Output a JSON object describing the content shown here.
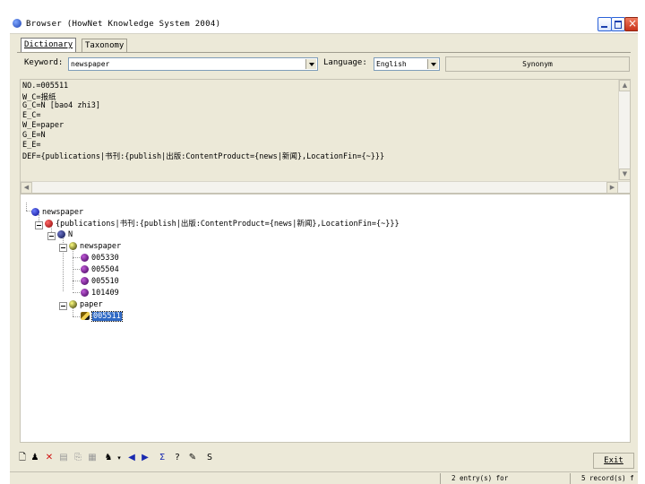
{
  "window": {
    "title": "Browser (HowNet Knowledge System 2004)",
    "icon": "app-globe-icon"
  },
  "tabs": [
    {
      "label": "Dictionary",
      "active": true
    },
    {
      "label": "Taxonomy",
      "active": false
    }
  ],
  "keyword": {
    "label": "Keyword:",
    "value": "newspaper"
  },
  "language": {
    "label": "Language:",
    "value": "English"
  },
  "synonym_button": "Synonym",
  "record_lines": [
    "NO.=005511",
    "W_C=报纸",
    "G_C=N [bao4 zhi3]",
    "E_C=",
    "W_E=paper",
    "G_E=N",
    "E_E=",
    "DEF={publications|书刊:{publish|出版:ContentProduct={news|新闻},LocationFin={~}}}"
  ],
  "tree": {
    "root": "newspaper",
    "def": "{publications|书刊:{publish|出版:ContentProduct={news|新闻},LocationFin={~}}}",
    "pos": "N",
    "groups": [
      {
        "label": "newspaper",
        "ids": [
          "005330",
          "005504",
          "005510",
          "101409"
        ]
      },
      {
        "label": "paper",
        "ids": [
          "005511"
        ],
        "selected": "005511"
      }
    ]
  },
  "toolbar": {
    "icons": [
      "new-doc-icon",
      "users-icon",
      "delete-icon",
      "filter-icon",
      "copy-icon",
      "paste-icon",
      "run-icon",
      "back-icon",
      "forward-icon",
      "sigma-icon",
      "help-icon",
      "note-icon",
      "s-icon"
    ],
    "exit_label": "Exit"
  },
  "status": {
    "entries": "2 entry(s) for",
    "records": "5 record(s) f"
  },
  "colors": {
    "window_bg": "#ece9d8",
    "selection": "#316ac5"
  }
}
